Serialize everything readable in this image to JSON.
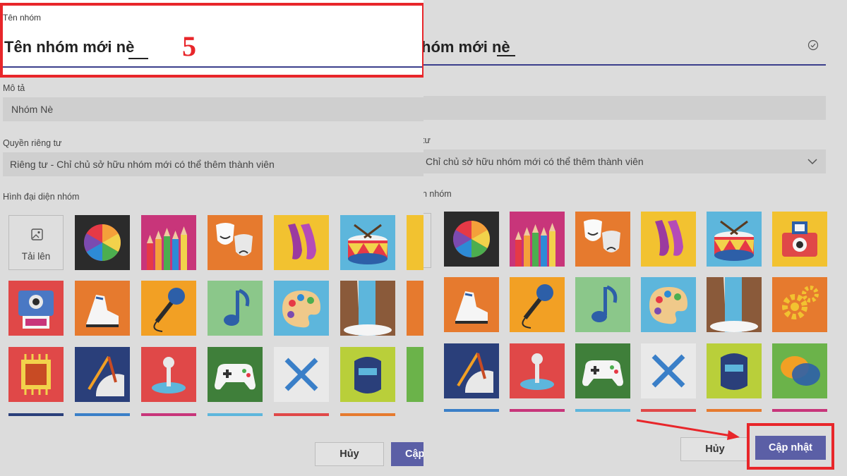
{
  "left": {
    "group_name_label": "Tên nhóm",
    "group_name_value": "Tên nhóm mới nè",
    "step_number": "5",
    "description_label": "Mô tả",
    "description_value": "Nhóm Nè",
    "privacy_label": "Quyền riêng tư",
    "privacy_value": "Riêng tư - Chỉ chủ sở hữu nhóm mới có thể thêm thành viên",
    "avatar_label": "Hình đại diện nhóm",
    "upload_label": "Tải lên",
    "cancel_label": "Hủy",
    "update_label_partial": "Cập"
  },
  "right": {
    "group_name_value_partial": "hóm mới nè",
    "privacy_value_partial": "Chỉ chủ sở hữu nhóm mới có thể thêm thành viên",
    "privacy_label_partial": "tư",
    "avatar_label_partial": "n nhóm",
    "cancel_label": "Hủy",
    "update_label": "Cập nhật"
  },
  "colors": {
    "accent": "#5b5fa6",
    "highlight_red": "#e8262a",
    "underline": "#3b3f8c"
  },
  "icons": [
    "color-wheel-icon",
    "pencils-icon",
    "theater-masks-icon",
    "ballet-shoes-icon",
    "drum-icon",
    "camera-icon",
    "instant-camera-icon",
    "sneaker-icon",
    "microphone-icon",
    "music-note-icon",
    "paint-palette-icon",
    "waterfall-icon",
    "gears-icon",
    "circuit-chip-icon",
    "drafting-tools-icon",
    "joystick-icon",
    "game-controller-icon",
    "wrench-screwdriver-icon",
    "welding-mask-icon",
    "chat-bubbles-icon"
  ]
}
